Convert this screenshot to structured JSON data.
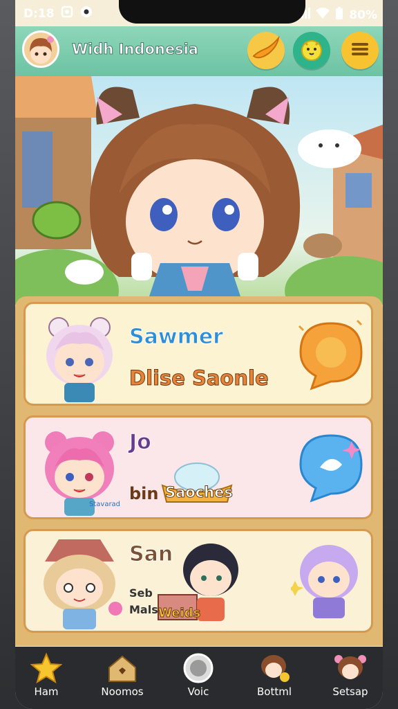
{
  "status": {
    "time": "D:18",
    "battery": "80%"
  },
  "header": {
    "title": "Widh Indonesia"
  },
  "cards": [
    {
      "title": "Sawmer",
      "subtitle": "Dlise Saonle"
    },
    {
      "title": "Jo",
      "line_prefix": "bin",
      "line_badge": "Saoches",
      "tag": "Stavarad"
    },
    {
      "title": "San",
      "line1": "Seb",
      "line2": "Mals",
      "badge": "Weids"
    }
  ],
  "nav": [
    {
      "label": "Ham",
      "icon": "star-icon"
    },
    {
      "label": "Noomos",
      "icon": "house-icon"
    },
    {
      "label": "Voic",
      "icon": "voice-icon"
    },
    {
      "label": "Bottml",
      "icon": "character-icon"
    },
    {
      "label": "Setsap",
      "icon": "avatar-icon"
    }
  ],
  "colors": {
    "header": "#7fcfb0",
    "accent_yellow": "#f6c33b",
    "card_border": "#d59a4f",
    "title_blue": "#2e8fd6",
    "subtitle_orange": "#e8843a"
  }
}
